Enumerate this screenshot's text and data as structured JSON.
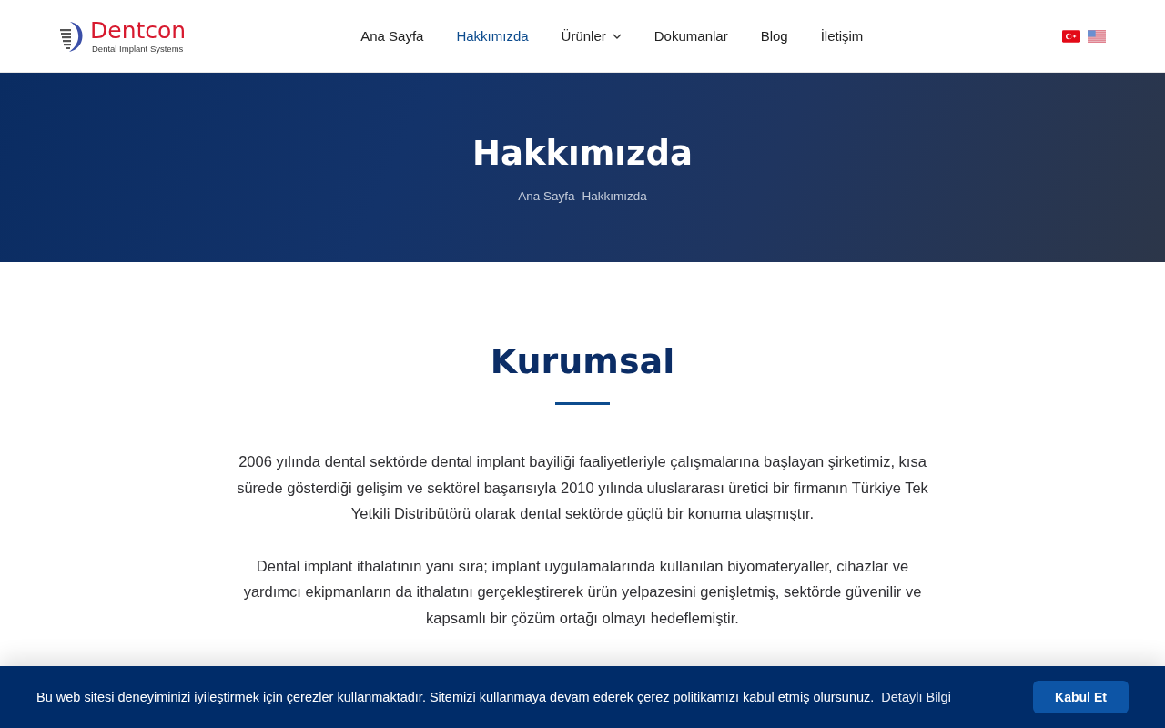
{
  "header": {
    "logo": {
      "name": "Dentcon",
      "tagline": "Dental Implant Systems"
    },
    "nav": [
      {
        "label": "Ana Sayfa",
        "selected": false,
        "dropdown": false
      },
      {
        "label": "Hakkımızda",
        "selected": true,
        "dropdown": false
      },
      {
        "label": "Ürünler",
        "selected": false,
        "dropdown": true
      },
      {
        "label": "Dokumanlar",
        "selected": false,
        "dropdown": false
      },
      {
        "label": "Blog",
        "selected": false,
        "dropdown": false
      },
      {
        "label": "İletişim",
        "selected": false,
        "dropdown": false
      }
    ],
    "languages": [
      {
        "kind": "tr"
      },
      {
        "kind": "us"
      }
    ]
  },
  "hero": {
    "title": "Hakkımızda",
    "breadcrumb": [
      "Ana Sayfa",
      "Hakkımızda"
    ]
  },
  "content": {
    "heading": "Kurumsal",
    "paragraphs": [
      "2006 yılında dental sektörde dental implant bayiliği faaliyetleriyle çalışmalarına başlayan şirketimiz, kısa sürede gösterdiği gelişim ve sektörel başarısıyla 2010 yılında uluslararası üretici bir firmanın Türkiye Tek Yetkili Distribütörü olarak dental sektörde güçlü bir konuma ulaşmıştır.",
      "Dental implant ithalatının yanı sıra; implant uygulamalarında kullanılan biyomateryaller, cihazlar ve yardımcı ekipmanların da ithalatını gerçekleştirerek ürün yelpazesini genişletmiş, sektörde güvenilir ve kapsamlı bir çözüm ortağı olmayı hedeflemiştir."
    ]
  },
  "cookie_bar": {
    "message": "Bu web sitesi deneyiminizi iyileştirmek için çerezler kullanmaktadır. Sitemizi kullanmaya devam ederek çerez politikamızı kabul etmiş olursunuz.",
    "link": "Detaylı Bilgi",
    "button": "Kabul Et"
  }
}
